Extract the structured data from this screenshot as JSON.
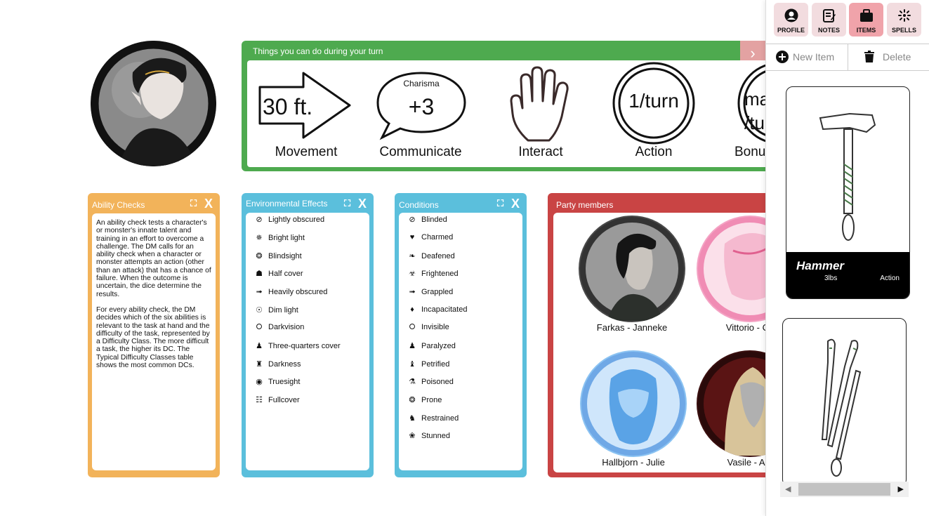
{
  "turn": {
    "title": "Things you can do during your turn",
    "next_icon": "chevron-right-icon",
    "movement": {
      "value": "30 ft.",
      "label": "Movement"
    },
    "communicate": {
      "caption": "Charisma",
      "value": "+3",
      "label": "Communicate"
    },
    "interact": {
      "label": "Interact"
    },
    "action": {
      "value": "1/turn",
      "label": "Action"
    },
    "bonus": {
      "value_line1": "ma",
      "value_line2": "/tu",
      "label": "Bonus"
    }
  },
  "sidebar": {
    "tabs": [
      {
        "label": "PROFILE",
        "icon": "profile-icon"
      },
      {
        "label": "NOTES",
        "icon": "notes-icon"
      },
      {
        "label": "ITEMS",
        "icon": "briefcase-icon"
      },
      {
        "label": "SPELLS",
        "icon": "sparkle-icon"
      }
    ],
    "active_tab": "ITEMS",
    "new_item": "New Item",
    "delete": "Delete",
    "items": [
      {
        "name": "Hammer",
        "weight": "3lbs",
        "type": "Action"
      },
      {
        "name": "",
        "weight": "",
        "type": ""
      }
    ]
  },
  "ability_checks": {
    "title": "Ability Checks",
    "paragraph1": "An ability check tests a character's or monster's innate talent and training in an effort to overcome a challenge. The DM calls for an ability check when a character or monster attempts an action (other than an attack) that has a chance of failure. When the outcome is uncertain, the dice determine the results.",
    "paragraph2": "For every ability check, the DM decides which of the six abilities is relevant to the task at hand and the difficulty of the task, represented by a Difficulty Class. The more difficult a task, the higher its DC. The Typical Difficulty Classes table shows the most common DCs."
  },
  "environmental": {
    "title": "Environmental Effects",
    "items": [
      "Lightly obscured",
      "Bright light",
      "Blindsight",
      "Half cover",
      "Heavily obscured",
      "Dim light",
      "Darkvision",
      "Three-quarters cover",
      "Darkness",
      "Truesight",
      "Fullcover"
    ]
  },
  "conditions": {
    "title": "Conditions",
    "items": [
      "Blinded",
      "Charmed",
      "Deafened",
      "Frightened",
      "Grappled",
      "Incapacitated",
      "Invisible",
      "Paralyzed",
      "Petrified",
      "Poisoned",
      "Prone",
      "Restrained",
      "Stunned"
    ]
  },
  "party": {
    "title": "Party members",
    "members": [
      {
        "name": "Farkas - Janneke"
      },
      {
        "name": "Vittorio - Ca"
      },
      {
        "name": "Hallbjorn - Julie"
      },
      {
        "name": "Vasile - Am"
      }
    ]
  },
  "colors": {
    "green": "#4eaa4f",
    "orange": "#f2b35a",
    "blue": "#5bbfdc",
    "red": "#c94444",
    "tab_bg": "#f2dcdf",
    "tab_active": "#f0a3aa"
  }
}
